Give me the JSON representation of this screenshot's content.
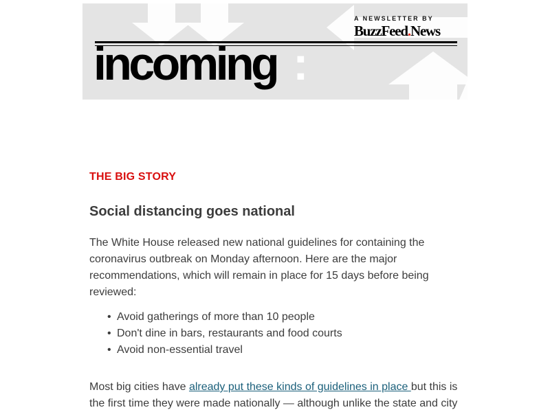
{
  "header": {
    "byline": "A NEWSLETTER BY",
    "brand_part1": "BuzzFeed",
    "brand_dot": ".",
    "brand_part2": "News",
    "logo_text": "incoming",
    "logo_colon": ":"
  },
  "story": {
    "section_label": "THE BIG STORY",
    "headline": "Social distancing goes national",
    "intro": "The White House released new national guidelines for containing the coronavirus outbreak on Monday afternoon. Here are the major recommendations, which will remain in place for 15 days before being reviewed:",
    "bullets": [
      "Avoid gatherings of more than 10 people",
      "Don't dine in bars, restaurants and food courts",
      "Avoid non-essential travel"
    ],
    "bullet_marker": "•",
    "para2_before_link": "Most big cities have ",
    "para2_link": "already put these kinds of guidelines in place ",
    "para2_after_link": "but this is the first time they were made nationally — although unlike the state and city"
  },
  "colors": {
    "banner_bg": "#e4e4e4",
    "accent_red": "#d90f0f",
    "link": "#1a5f7a",
    "body_text": "#3c3c3c"
  }
}
